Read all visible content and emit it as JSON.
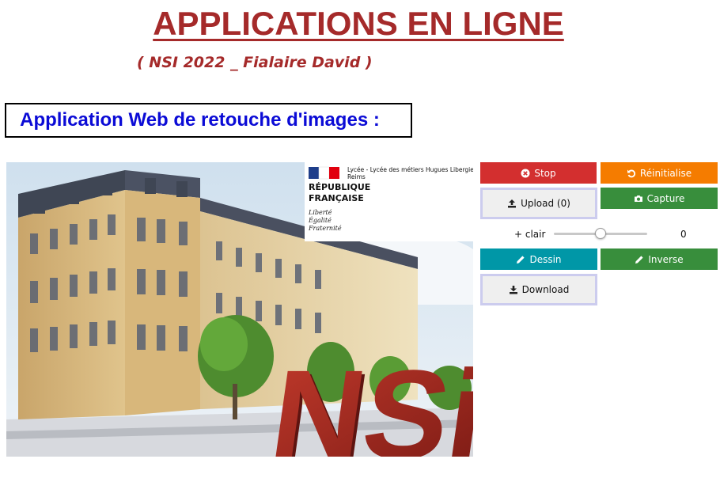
{
  "header": {
    "title": "APPLICATIONS EN LIGNE",
    "subtitle": "( NSI 2022 _ Fialaire David )"
  },
  "section": {
    "title": "Application Web de retouche d'images :"
  },
  "photo": {
    "institution": "Lycée - Lycée des métiers Hugues Libergier",
    "city": "Reims",
    "republic_line1": "RÉPUBLIQUE",
    "republic_line2": "FRANÇAISE",
    "motto_1": "Liberté",
    "motto_2": "Égalité",
    "motto_3": "Fraternité",
    "logo_text": "NSi"
  },
  "controls": {
    "stop_label": "Stop",
    "reset_label": "Réinitialise",
    "upload_label": "Upload (0)",
    "capture_label": "Capture",
    "slider_label": "+ clair",
    "slider_value": "0",
    "slider_level": 0.5,
    "draw_label": "Dessin",
    "inverse_label": "Inverse",
    "download_label": "Download"
  },
  "colors": {
    "title": "#a52a2a",
    "section_title": "#0b0bd6",
    "stop": "#d32f2f",
    "reset": "#f57c00",
    "capture": "#388e3c",
    "draw": "#0097a7",
    "inverse": "#388e3c"
  },
  "icons": {
    "stop": "times-circle-icon",
    "reset": "undo-icon",
    "upload": "upload-icon",
    "capture": "camera-icon",
    "draw": "pencil-icon",
    "inverse": "pencil-icon",
    "download": "download-icon"
  }
}
